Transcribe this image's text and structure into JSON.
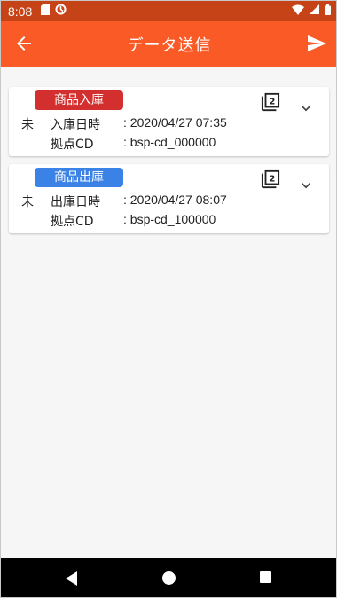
{
  "status_bar": {
    "time": "8:08",
    "icons": [
      "sd-card-icon",
      "sync-icon",
      "wifi-icon",
      "signal-icon",
      "battery-icon"
    ]
  },
  "app_bar": {
    "title": "データ送信",
    "back_icon": "arrow-back-icon",
    "send_icon": "send-icon"
  },
  "records": [
    {
      "type": "商品入庫",
      "badge_color": "#d32f2f",
      "status": "未",
      "date_label": "入庫日時",
      "date_value": ": 2020/04/27 07:35",
      "site_label": "拠点CD",
      "site_value": ": bsp-cd_000000",
      "copy_count": "2"
    },
    {
      "type": "商品出庫",
      "badge_color": "#3b82e6",
      "status": "未",
      "date_label": "出庫日時",
      "date_value": ": 2020/04/27 08:07",
      "site_label": "拠点CD",
      "site_value": ": bsp-cd_100000",
      "copy_count": "2"
    }
  ],
  "colors": {
    "status_bar": "#c64318",
    "app_bar": "#fa5a25",
    "background": "#f6f6f6"
  }
}
